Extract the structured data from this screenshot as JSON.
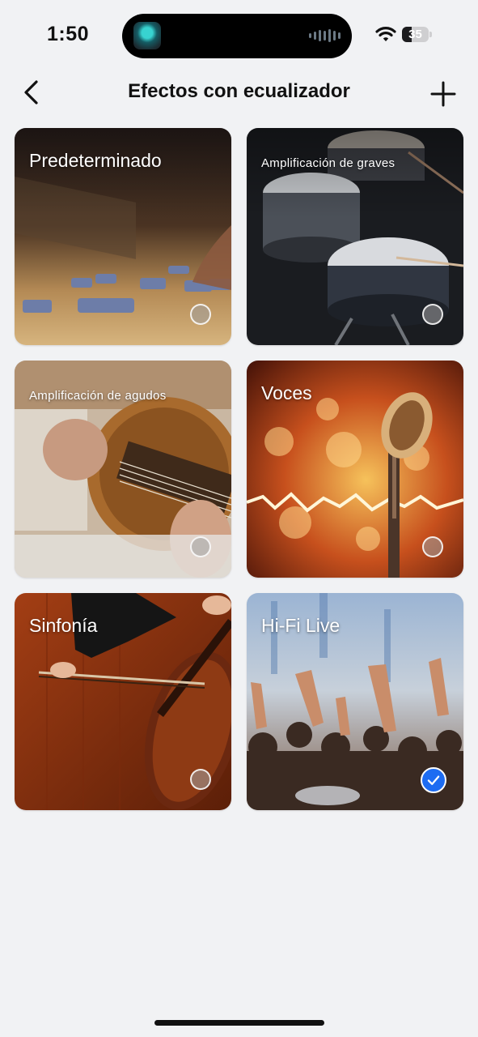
{
  "status_bar": {
    "time": "1:50",
    "battery_level": "35",
    "battery_fraction": 0.35
  },
  "nav": {
    "title": "Efectos con ecualizador",
    "back_icon": "chevron-left-icon",
    "add_icon": "plus-icon"
  },
  "presets": [
    {
      "label": "Predeterminado",
      "image": "mixing-console",
      "selected": false
    },
    {
      "label": "Amplificación de graves",
      "image": "drum-kit",
      "selected": false
    },
    {
      "label": "Amplificación de agudos",
      "image": "acoustic-guitar",
      "selected": false
    },
    {
      "label": "Voces",
      "image": "microphone",
      "selected": false
    },
    {
      "label": "Sinfonía",
      "image": "cello",
      "selected": false
    },
    {
      "label": "Hi-Fi Live",
      "image": "concert-crowd",
      "selected": true
    }
  ],
  "colors": {
    "background": "#f1f2f4",
    "accent": "#1d6cf2",
    "text": "#111111"
  }
}
